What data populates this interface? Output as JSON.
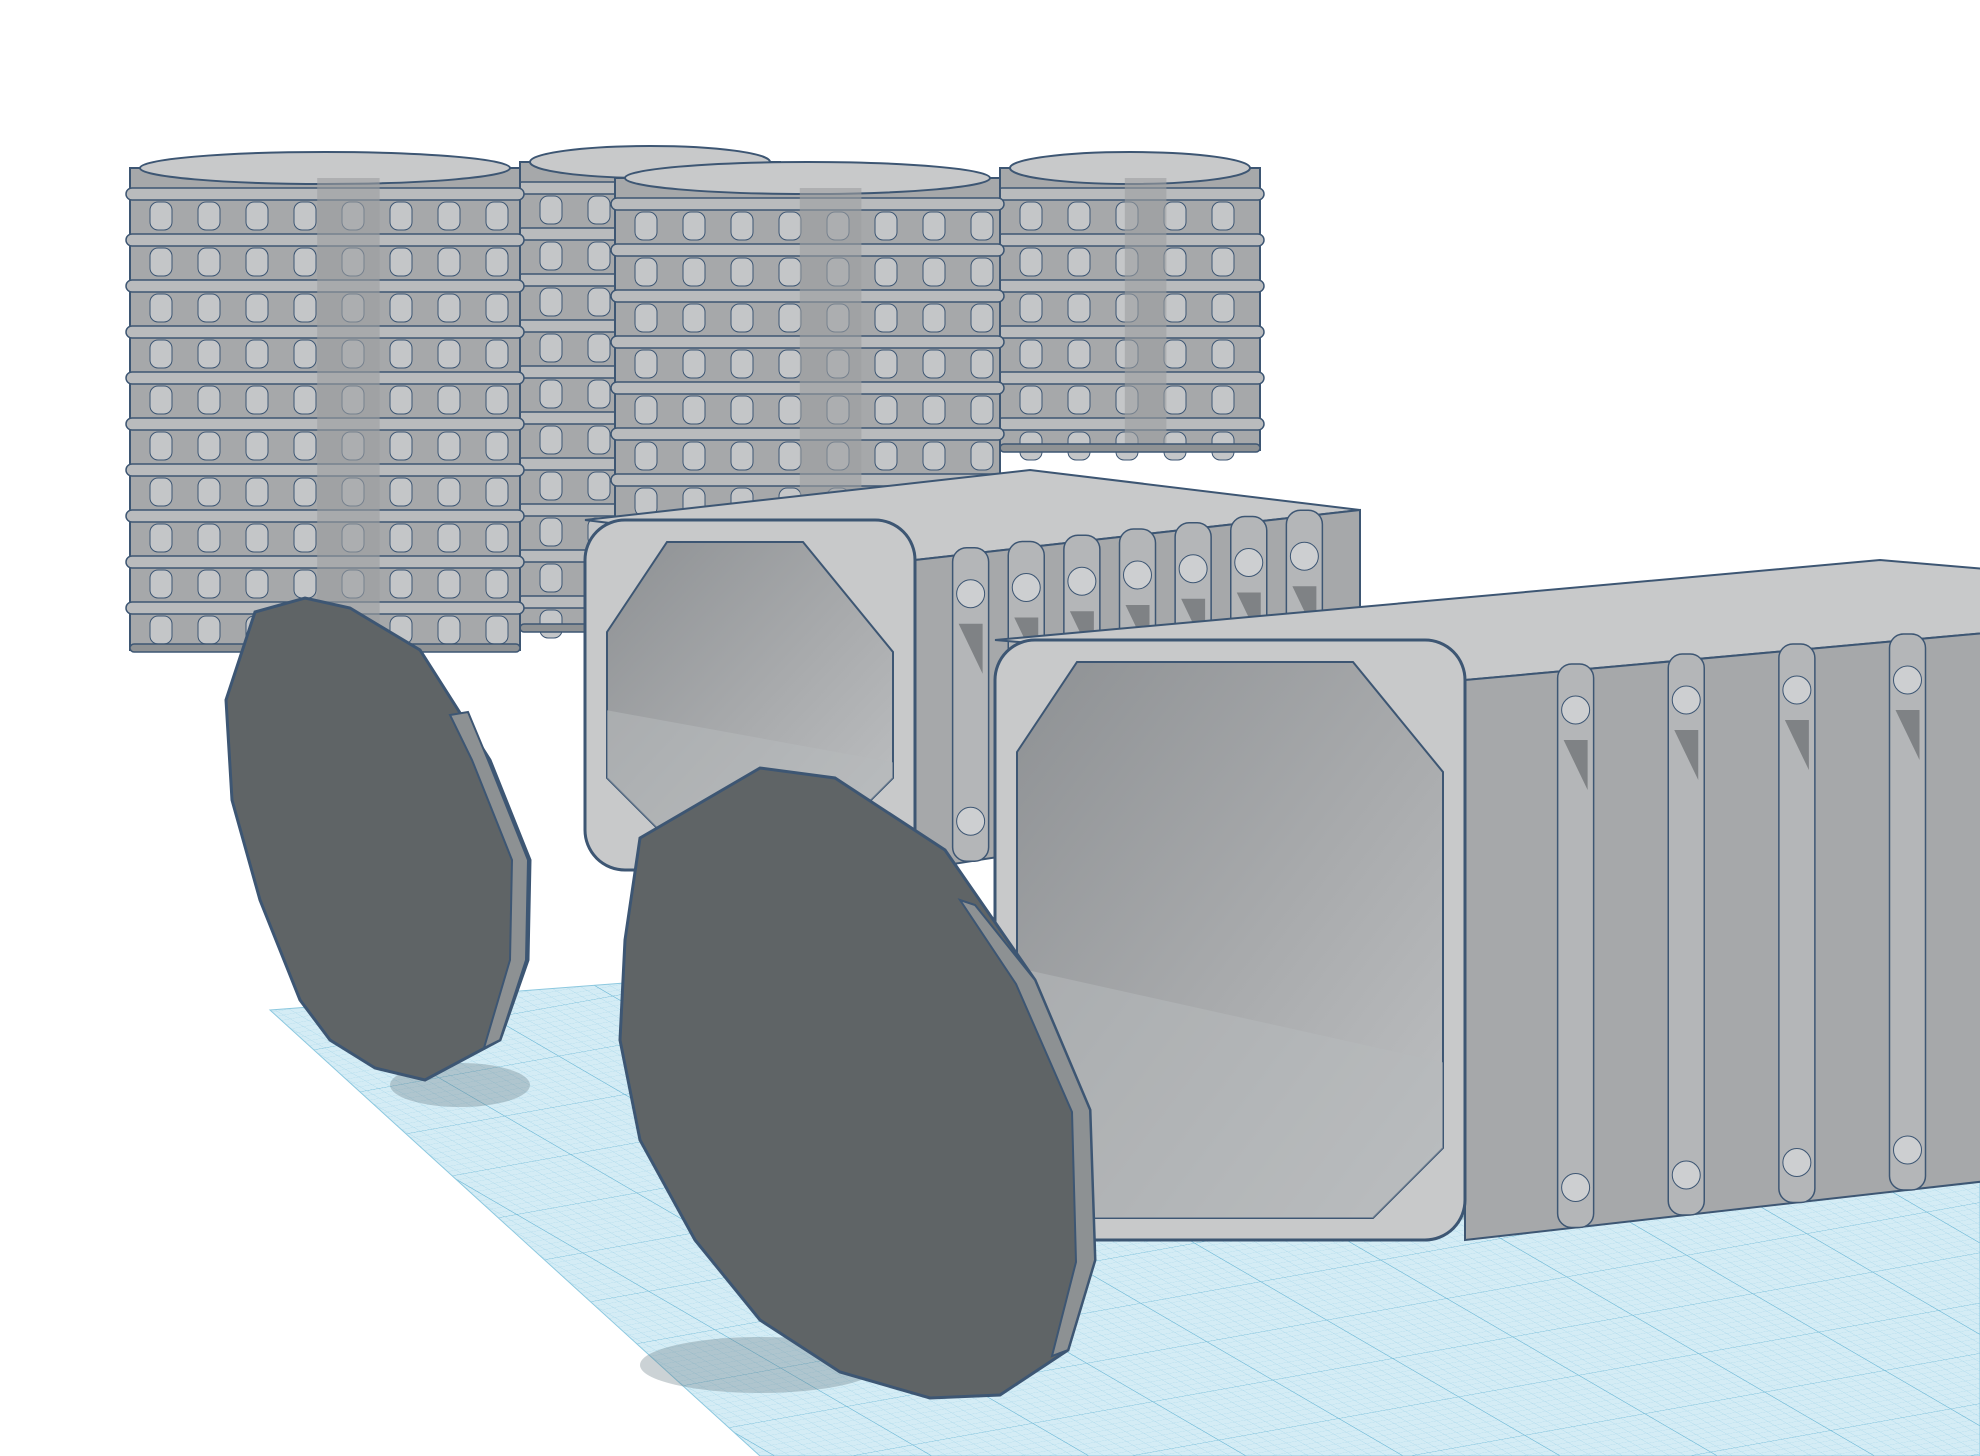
{
  "scene": {
    "background": "#ffffff",
    "workplane": {
      "fill": "#d4ecf5",
      "minor_grid": "#a9d7ea",
      "major_grid": "#6fb9d6"
    },
    "shape_colors": {
      "face_light": "#c8c9ca",
      "face_mid": "#a6a8aa",
      "face_dark": "#5f6466",
      "interior": "#9ea0a2",
      "interior_floor": "#b7b9bb",
      "outline": "#3d5673",
      "shadow": "#6a7d88"
    },
    "objects": [
      {
        "name": "stacked-segment-column",
        "count": 4
      },
      {
        "name": "octagonal-end-cap",
        "count": 2
      },
      {
        "name": "hinged-tube-section",
        "count": 2
      }
    ]
  }
}
